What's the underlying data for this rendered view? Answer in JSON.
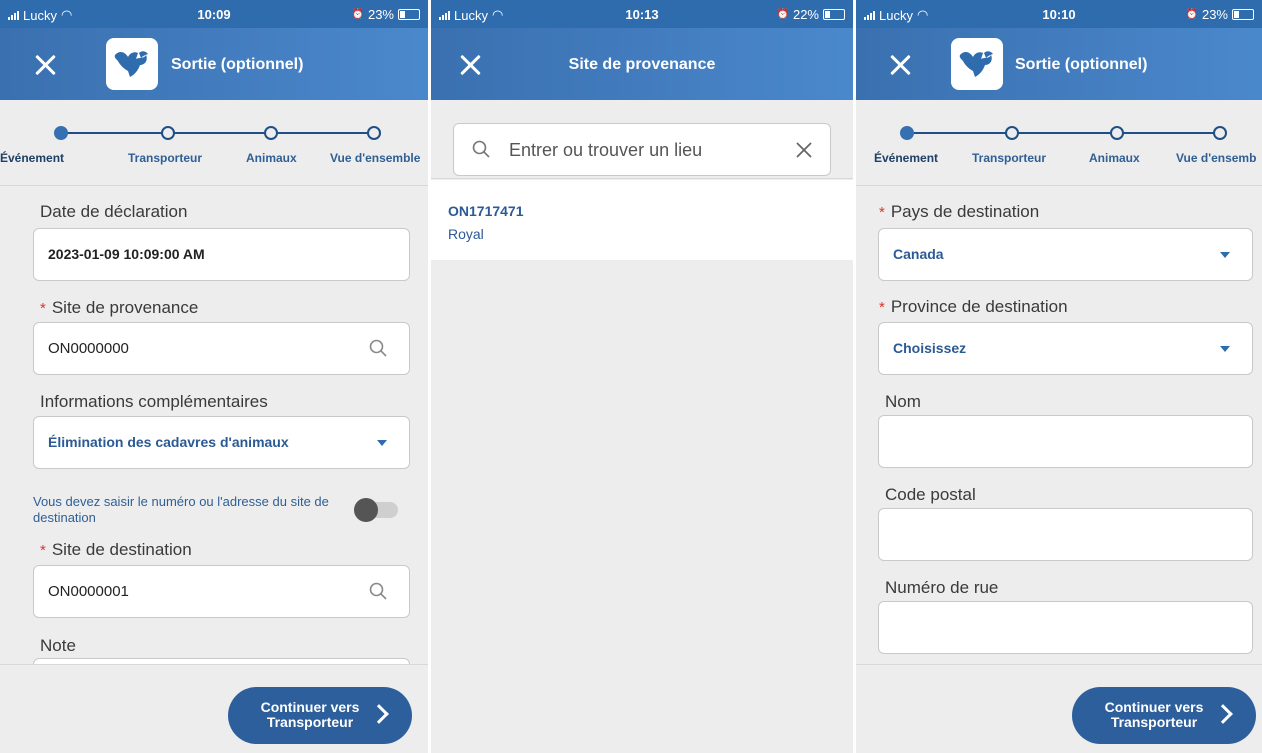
{
  "status_bars": [
    {
      "carrier": "Lucky",
      "time": "10:09",
      "battery": "23%"
    },
    {
      "carrier": "Lucky",
      "time": "10:13",
      "battery": "22%"
    },
    {
      "carrier": "Lucky",
      "time": "10:10",
      "battery": "23%"
    }
  ],
  "screen1": {
    "title": "Sortie (optionnel)",
    "steps": [
      "Événement",
      "Transporteur",
      "Animaux",
      "Vue d'ensemble"
    ],
    "date_label": "Date de déclaration",
    "date_value": "2023-01-09 10:09:00 AM",
    "origin_label": "Site de provenance",
    "origin_value": "ON0000000",
    "info_label": "Informations complémentaires",
    "info_value": "Élimination des cadavres d'animaux",
    "toggle_hint": "Vous devez saisir le numéro ou l'adresse du site de destination",
    "toggle_on": false,
    "dest_label": "Site de destination",
    "dest_value": "ON0000001",
    "note_label": "Note",
    "continue_label": "Continuer vers Transporteur"
  },
  "screen2": {
    "title": "Site de provenance",
    "search_placeholder": "Entrer ou trouver un lieu",
    "results": [
      {
        "id": "ON1717471",
        "name": "Royal"
      }
    ]
  },
  "screen3": {
    "title": "Sortie (optionnel)",
    "steps": [
      "Événement",
      "Transporteur",
      "Animaux",
      "Vue d'ensemb"
    ],
    "country_label": "Pays de destination",
    "country_value": "Canada",
    "province_label": "Province de destination",
    "province_value": "Choisissez",
    "name_label": "Nom",
    "postal_label": "Code postal",
    "street_label": "Numéro de rue",
    "continue_label": "Continuer vers Transporteur"
  },
  "colors": {
    "header": "#3d78bb",
    "accent": "#2c5f9c",
    "required": "#d9352b",
    "link_text": "#2b5a95"
  }
}
